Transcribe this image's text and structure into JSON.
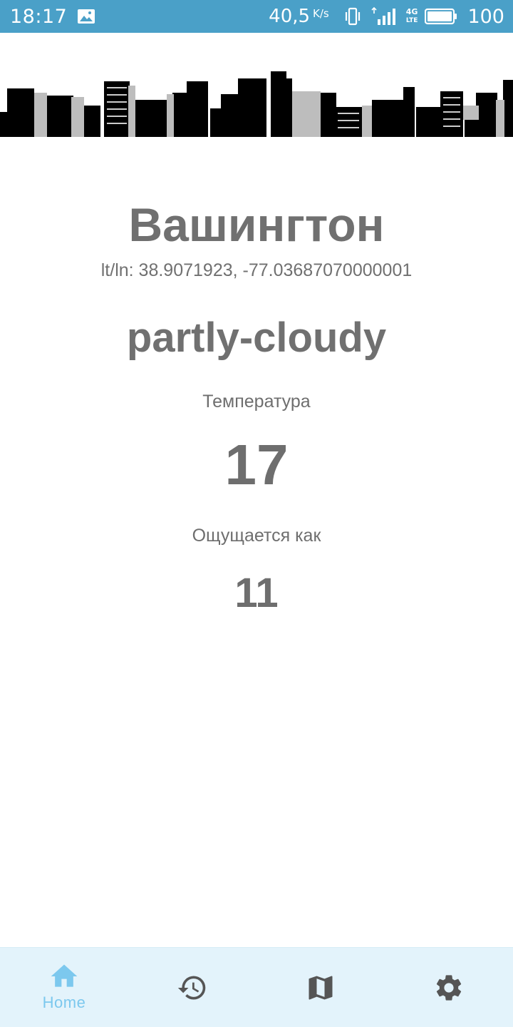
{
  "status_bar": {
    "time": "18:17",
    "net_speed": "40,5",
    "net_speed_unit": "K/s",
    "network_type": "4G",
    "battery": "100",
    "icons": [
      "gallery-icon",
      "vibrate-icon",
      "signal-icon",
      "battery-icon"
    ]
  },
  "weather": {
    "city": "Вашингтон",
    "coords": "lt/ln: 38.9071923, -77.03687070000001",
    "condition": "partly-cloudy",
    "temperature_label": "Температура",
    "temperature": "17",
    "feels_like_label": "Ощущается как",
    "feels_like": "11"
  },
  "bottom_nav": {
    "items": [
      {
        "label": "Home",
        "icon": "home-icon",
        "active": true
      },
      {
        "label": "",
        "icon": "history-icon",
        "active": false
      },
      {
        "label": "",
        "icon": "map-icon",
        "active": false
      },
      {
        "label": "",
        "icon": "settings-icon",
        "active": false
      }
    ]
  },
  "colors": {
    "status_bar": "#4aa0c8",
    "text_primary": "#707070",
    "nav_background": "#e3f3fb",
    "nav_active": "#7cc8ee",
    "nav_inactive": "#555555"
  }
}
